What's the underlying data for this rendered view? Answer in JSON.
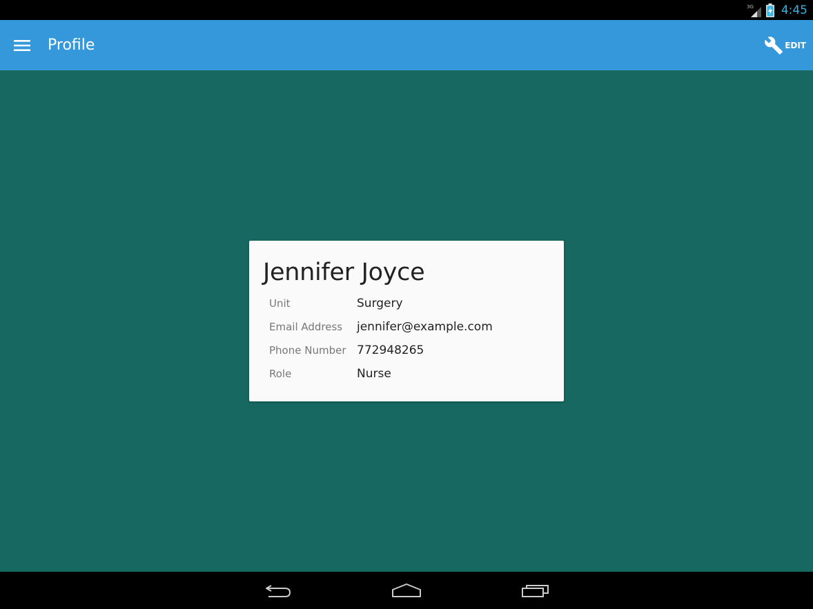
{
  "status_bar": {
    "network_label": "3G",
    "time": "4:45",
    "clock_color": "#33b5e5",
    "icons": [
      "signal-icon",
      "battery-charging-icon"
    ]
  },
  "app_bar": {
    "title": "Profile",
    "edit_label": "EDIT",
    "background": "#3498db",
    "icons": [
      "menu-icon",
      "wrench-icon"
    ]
  },
  "content": {
    "background": "#176861"
  },
  "profile": {
    "name": "Jennifer Joyce",
    "fields": [
      {
        "label": "Unit",
        "value": "Surgery"
      },
      {
        "label": "Email Address",
        "value": "jennifer@example.com"
      },
      {
        "label": "Phone Number",
        "value": "772948265"
      },
      {
        "label": "Role",
        "value": "Nurse"
      }
    ]
  },
  "nav_bar": {
    "icons": [
      "back-icon",
      "home-icon",
      "recent-apps-icon"
    ]
  }
}
